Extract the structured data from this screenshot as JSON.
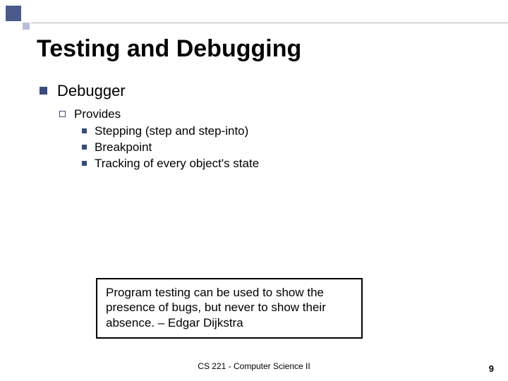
{
  "title": "Testing and Debugging",
  "bullet1": "Debugger",
  "bullet2": "Provides",
  "bullet3a": "Stepping (step and step-into)",
  "bullet3b": "Breakpoint",
  "bullet3c": "Tracking of every object's state",
  "quote": "Program testing can be used to show the presence of bugs, but never to show their absence. – Edgar Dijkstra",
  "footer_center": "CS 221 - Computer Science II",
  "page_number": "9"
}
